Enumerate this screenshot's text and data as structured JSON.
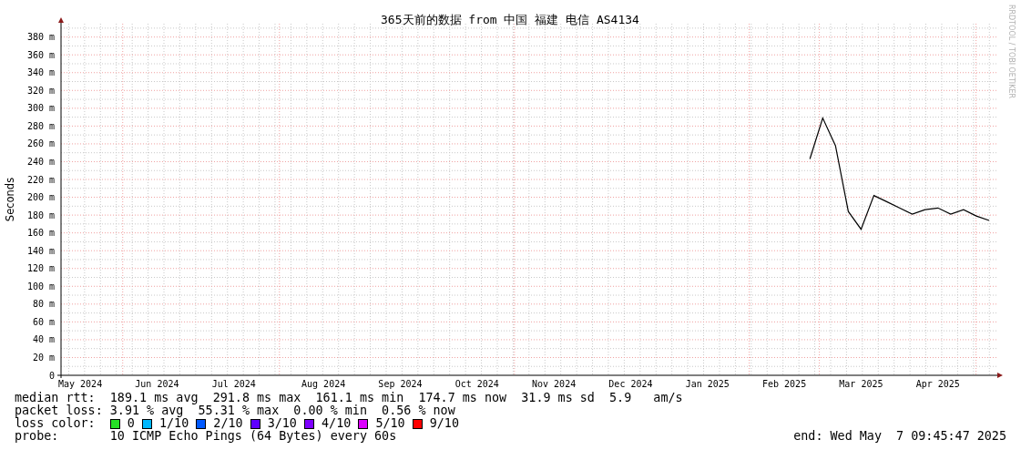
{
  "chart": {
    "credit": "RRDTOOL / TOBI OETIKER",
    "chart_data": {
      "type": "line",
      "title": "365天前的数据 from 中国 福建 电信 AS4134",
      "ylabel": "Seconds",
      "categories": [
        null,
        "May 2024",
        null,
        null,
        null,
        null,
        null,
        "Jun 2024",
        null,
        null,
        null,
        null,
        null,
        "Jul 2024",
        null,
        null,
        null,
        null,
        null,
        null,
        "Aug 2024",
        null,
        null,
        null,
        null,
        null,
        "Sep 2024",
        null,
        null,
        null,
        null,
        null,
        "Oct 2024",
        null,
        null,
        null,
        null,
        null,
        "Nov 2024",
        null,
        null,
        null,
        null,
        null,
        "Dec 2024",
        null,
        null,
        null,
        null,
        null,
        "Jan 2025",
        null,
        null,
        null,
        null,
        null,
        "Feb 2025",
        null,
        null,
        null,
        null,
        null,
        "Mar 2025",
        null,
        null,
        null,
        null,
        null,
        "Apr 2025",
        null,
        null,
        null,
        null
      ],
      "series": [
        {
          "color": "#000000",
          "values": [
            null,
            null,
            null,
            null,
            null,
            null,
            null,
            null,
            null,
            null,
            null,
            null,
            null,
            null,
            null,
            null,
            null,
            null,
            null,
            null,
            null,
            null,
            null,
            null,
            null,
            null,
            null,
            null,
            null,
            null,
            null,
            null,
            null,
            null,
            null,
            null,
            null,
            null,
            null,
            null,
            null,
            null,
            null,
            null,
            null,
            null,
            null,
            null,
            null,
            null,
            null,
            null,
            null,
            null,
            null,
            null,
            null,
            null,
            243,
            289,
            258,
            184,
            164,
            202,
            195,
            188,
            181,
            186,
            188,
            181,
            186,
            179,
            174
          ]
        }
      ],
      "grid": true,
      "ylim": [
        0,
        395
      ],
      "yticks": [
        {
          "value": 0,
          "label": "0"
        },
        {
          "value": 20,
          "label": "20 m"
        },
        {
          "value": 40,
          "label": "40 m"
        },
        {
          "value": 60,
          "label": "60 m"
        },
        {
          "value": 80,
          "label": "80 m"
        },
        {
          "value": 100,
          "label": "100 m"
        },
        {
          "value": 120,
          "label": "120 m"
        },
        {
          "value": 140,
          "label": "140 m"
        },
        {
          "value": 160,
          "label": "160 m"
        },
        {
          "value": 180,
          "label": "180 m"
        },
        {
          "value": 200,
          "label": "200 m"
        },
        {
          "value": 220,
          "label": "220 m"
        },
        {
          "value": 240,
          "label": "240 m"
        },
        {
          "value": 260,
          "label": "260 m"
        },
        {
          "value": 280,
          "label": "280 m"
        },
        {
          "value": 300,
          "label": "300 m"
        },
        {
          "value": 320,
          "label": "320 m"
        },
        {
          "value": 340,
          "label": "340 m"
        },
        {
          "value": 360,
          "label": "360 m"
        },
        {
          "value": 380,
          "label": "380 m"
        }
      ]
    }
  },
  "stats": [
    {
      "label": "median rtt:",
      "value": "189.1 ms avg  291.8 ms max  161.1 ms min  174.7 ms now  31.9 ms sd  5.9   am/s"
    },
    {
      "label": "packet loss:",
      "value": "3.91 % avg  55.31 % max  0.00 % min  0.56 % now"
    }
  ],
  "loss_color": {
    "label": "loss color:",
    "items": [
      {
        "label": "0",
        "color": "#26e026"
      },
      {
        "label": "1/10",
        "color": "#00b8ff"
      },
      {
        "label": "2/10",
        "color": "#0059ff"
      },
      {
        "label": "3/10",
        "color": "#5e00ff"
      },
      {
        "label": "4/10",
        "color": "#7e00ff"
      },
      {
        "label": "5/10",
        "color": "#dd00ff"
      },
      {
        "label": "9/10",
        "color": "#ff0000"
      }
    ]
  },
  "probe": {
    "label": "probe:",
    "value": "10 ICMP Echo Pings (64 Bytes) every 60s"
  },
  "end": "end: Wed May  7 09:45:47 2025"
}
